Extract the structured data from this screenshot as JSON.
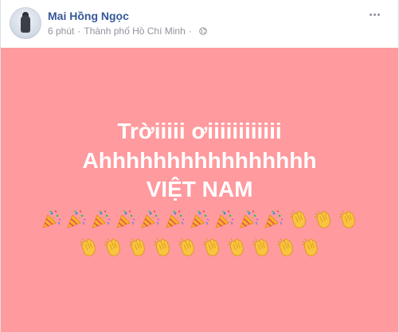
{
  "post": {
    "author": "Mai Hồng Ngọc",
    "time": "6 phút",
    "separator": "·",
    "location": "Thành phố Hồ Chí Minh",
    "privacy_icon": "globe-icon",
    "options_icon": "more-options-icon",
    "card_background": "#ff9a9e",
    "text_lines": [
      "Trờiiiii ơiiiiiiiiiiii",
      "Ahhhhhhhhhhhhhhhh",
      "VIỆT NAM"
    ],
    "emoji_rows": [
      [
        "party-popper",
        "party-popper",
        "party-popper",
        "party-popper",
        "party-popper",
        "party-popper",
        "party-popper",
        "party-popper",
        "party-popper",
        "party-popper",
        "clapping-hands",
        "clapping-hands",
        "clapping-hands"
      ],
      [
        "clapping-hands",
        "clapping-hands",
        "clapping-hands",
        "clapping-hands",
        "clapping-hands",
        "clapping-hands",
        "clapping-hands",
        "clapping-hands",
        "clapping-hands",
        "clapping-hands"
      ]
    ]
  }
}
